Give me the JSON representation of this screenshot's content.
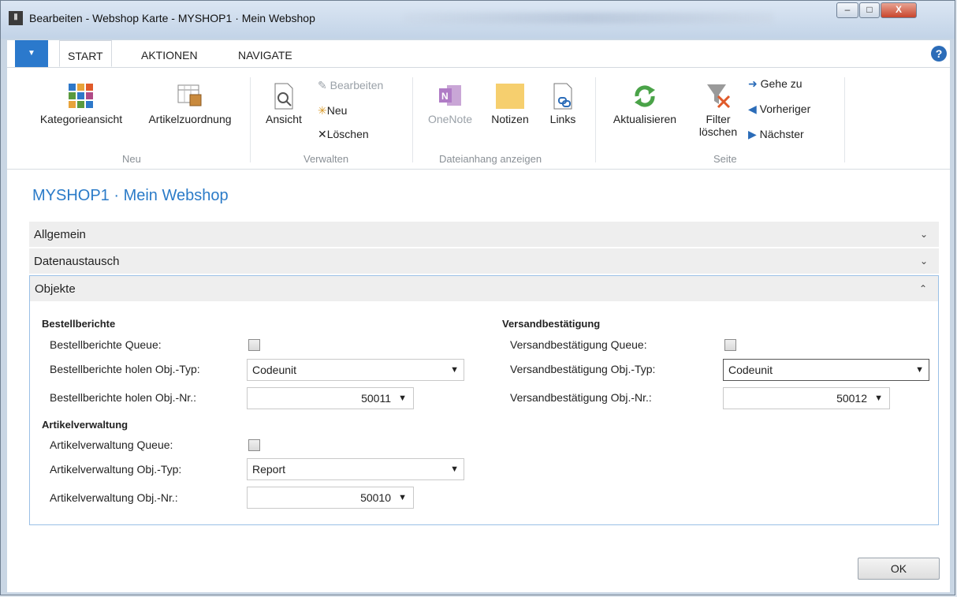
{
  "window": {
    "title": "Bearbeiten - Webshop Karte - MYSHOP1 · Mein Webshop",
    "minimize": "–",
    "maximize": "□",
    "close": "X"
  },
  "tabs": [
    {
      "label": "START"
    },
    {
      "label": "AKTIONEN"
    },
    {
      "label": "NAVIGATE"
    }
  ],
  "ribbon": {
    "groups": {
      "neu": "Neu",
      "verwalten": "Verwalten",
      "dateianhang": "Dateianhang anzeigen",
      "seite": "Seite"
    },
    "kategorieansicht": "Kategorieansicht",
    "artikelzuordnung": "Artikelzuordnung",
    "ansicht": "Ansicht",
    "bearbeiten": "Bearbeiten",
    "neu": "Neu",
    "loeschen": "Löschen",
    "onenote": "OneNote",
    "notizen": "Notizen",
    "links": "Links",
    "aktualisieren": "Aktualisieren",
    "filter": "Filter",
    "filter2": "löschen",
    "gehezu": "Gehe zu",
    "vorheriger": "Vorheriger",
    "naechster": "Nächster"
  },
  "page": {
    "title": "MYSHOP1 · Mein Webshop",
    "fasttabs": [
      "Allgemein",
      "Datenaustausch",
      "Objekte"
    ]
  },
  "objekte": {
    "bestell": {
      "head": "Bestellberichte",
      "queue_label": "Bestellberichte Queue:",
      "queue_checked": false,
      "typ_label": "Bestellberichte holen Obj.-Typ:",
      "typ_value": "Codeunit",
      "nr_label": "Bestellberichte holen Obj.-Nr.:",
      "nr_value": "50011"
    },
    "artikel": {
      "head": "Artikelverwaltung",
      "queue_label": "Artikelverwaltung Queue:",
      "queue_checked": false,
      "typ_label": "Artikelverwaltung Obj.-Typ:",
      "typ_value": "Report",
      "nr_label": "Artikelverwaltung Obj.-Nr.:",
      "nr_value": "50010"
    },
    "versand": {
      "head": "Versandbestätigung",
      "queue_label": "Versandbestätigung Queue:",
      "queue_checked": false,
      "typ_label": "Versandbestätigung Obj.-Typ:",
      "typ_value": "Codeunit",
      "nr_label": "Versandbestätigung Obj.-Nr.:",
      "nr_value": "50012"
    }
  },
  "ok_label": "OK",
  "colors": {
    "accent": "#2b79cc",
    "title_blue": "#2b7bc8",
    "section_border": "#9ac0e6"
  }
}
